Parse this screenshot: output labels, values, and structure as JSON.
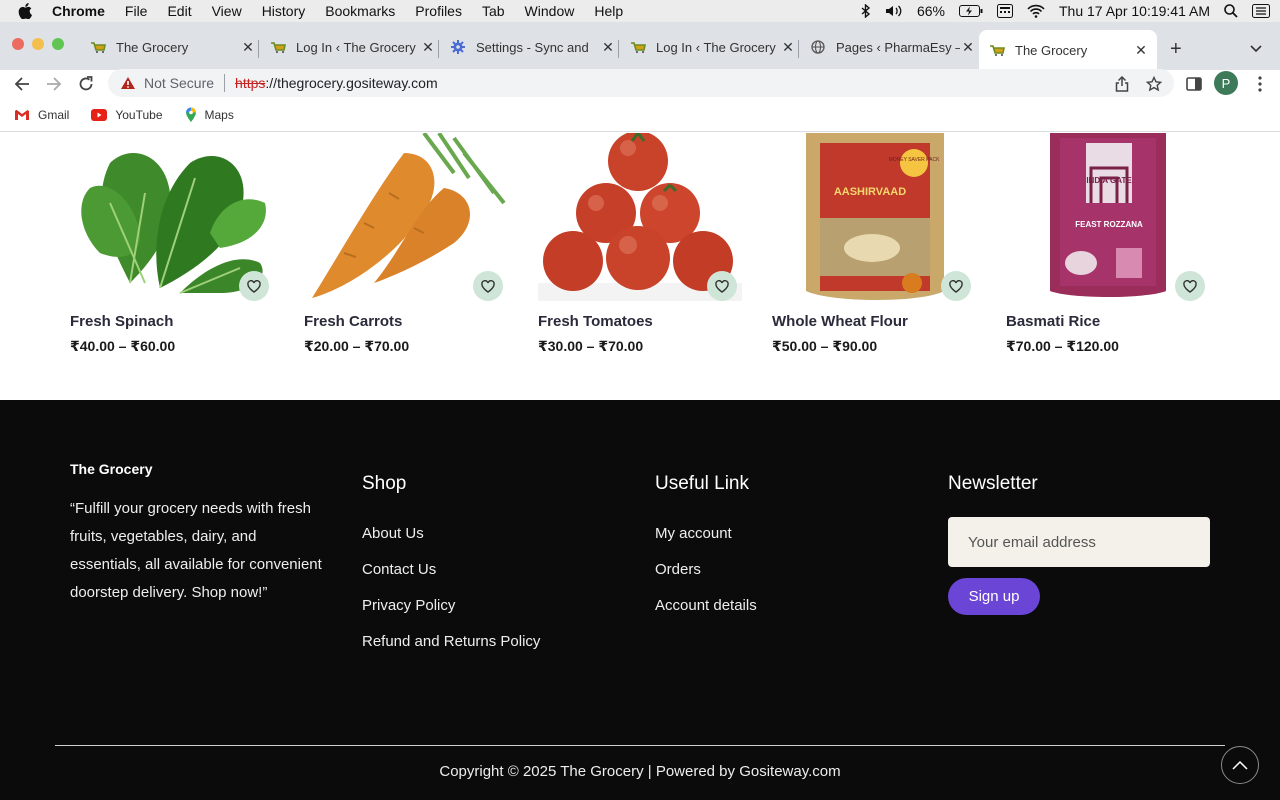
{
  "menubar": {
    "app": "Chrome",
    "items": [
      "File",
      "Edit",
      "View",
      "History",
      "Bookmarks",
      "Profiles",
      "Tab",
      "Window",
      "Help"
    ],
    "battery": "66%",
    "datetime": "Thu 17 Apr  10:19:41 AM"
  },
  "tabs": [
    {
      "title": "The Grocery",
      "active": false
    },
    {
      "title": "Log In ‹ The Grocery",
      "active": false
    },
    {
      "title": "Settings - Sync and",
      "active": false
    },
    {
      "title": "Log In ‹ The Grocery",
      "active": false
    },
    {
      "title": "Pages ‹ PharmaEsy –",
      "active": false
    },
    {
      "title": "The Grocery",
      "active": true
    }
  ],
  "toolbar": {
    "security": "Not Secure",
    "url_scheme": "https",
    "url_rest": "://thegrocery.gositeway.com",
    "profile_initial": "P"
  },
  "bookmarks": [
    {
      "label": "Gmail",
      "icon": "gmail-icon"
    },
    {
      "label": "YouTube",
      "icon": "youtube-icon"
    },
    {
      "label": "Maps",
      "icon": "maps-icon"
    }
  ],
  "products": [
    {
      "name": "Fresh Spinach",
      "price": "₹40.00 – ₹60.00"
    },
    {
      "name": "Fresh Carrots",
      "price": "₹20.00 – ₹70.00"
    },
    {
      "name": "Fresh Tomatoes",
      "price": "₹30.00 – ₹70.00"
    },
    {
      "name": "Whole Wheat Flour",
      "price": "₹50.00 – ₹90.00",
      "pack_brand": "AASHIRVAAD",
      "pack_badge": "MONEY SAVER PACK"
    },
    {
      "name": "Basmati Rice",
      "price": "₹70.00 – ₹120.00",
      "pack_brand": "INDIA GATE",
      "pack_variant": "FEAST ROZZANA"
    }
  ],
  "footer": {
    "brand": "The Grocery",
    "about": "“Fulfill your grocery needs with fresh fruits, vegetables, dairy, and essentials, all available for convenient doorstep delivery. Shop now!”",
    "shop": {
      "heading": "Shop",
      "links": [
        "About Us",
        "Contact Us",
        "Privacy Policy",
        "Refund and Returns Policy"
      ]
    },
    "useful": {
      "heading": "Useful Link",
      "links": [
        "My account",
        "Orders",
        "Account details"
      ]
    },
    "newsletter": {
      "heading": "Newsletter",
      "placeholder": "Your email address",
      "button": "Sign up"
    },
    "copyright": "Copyright © 2025 The Grocery | Powered by Gositeway.com"
  },
  "colors": {
    "footer_bg": "#0b0b0b",
    "accent_purple": "#6a45d6",
    "wishlist_bg": "#cfe5d8"
  }
}
